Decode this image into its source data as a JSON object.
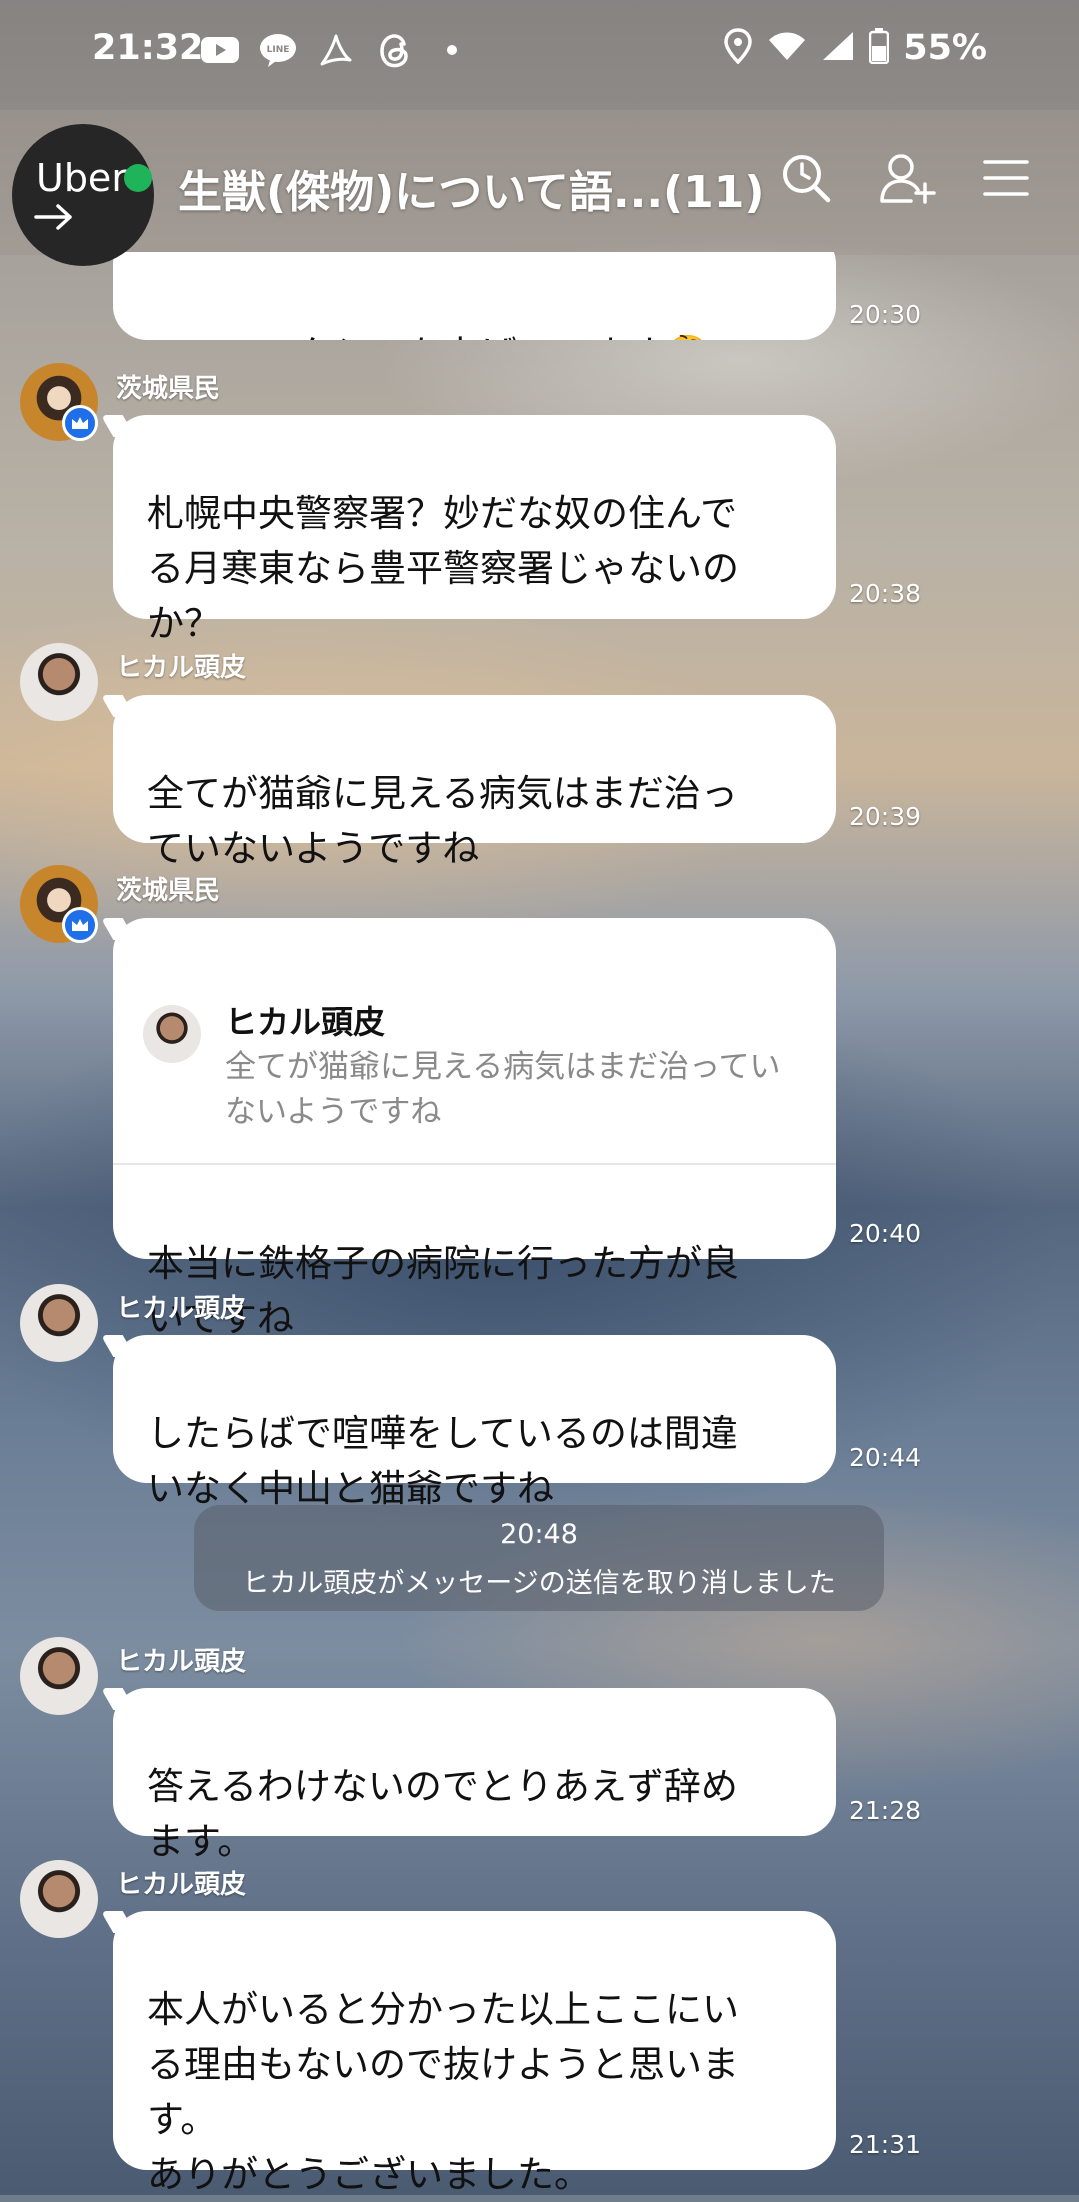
{
  "status_bar": {
    "time": "21:32",
    "battery": "55%",
    "left_icons": [
      "youtube-icon",
      "line-icon",
      "acrobat-icon",
      "threads-icon",
      "dot-icon"
    ],
    "right_icons": [
      "location-icon",
      "wifi-icon",
      "signal-icon",
      "battery-icon"
    ]
  },
  "overlay": {
    "uber_label": "Uber"
  },
  "header": {
    "title": "生獣(傑物)について語...(11)",
    "buttons": [
      "search-icon",
      "add-friend-icon",
      "menu-icon"
    ]
  },
  "messages": [
    {
      "type": "text",
      "sender": "",
      "text": "ここのスクショを上げています🤔",
      "time": "20:30"
    },
    {
      "type": "text",
      "sender": "茨城県民",
      "text": "札幌中央警察署？妙だな奴の住んで\nる月寒東なら豊平警察署じゃないの\nか？",
      "time": "20:38"
    },
    {
      "type": "text",
      "sender": "ヒカル頭皮",
      "text": "全てが猫爺に見える病気はまだ治っ\nていないようですね",
      "time": "20:39"
    },
    {
      "type": "reply",
      "sender": "茨城県民",
      "reply_to_name": "ヒカル頭皮",
      "reply_to_text": "全てが猫爺に見える病気はまだ治ってい\nないようですね",
      "text": "本当に鉄格子の病院に行った方が良\nいですね",
      "time": "20:40"
    },
    {
      "type": "text",
      "sender": "ヒカル頭皮",
      "text": "したらばで喧嘩をしているのは間違\nいなく中山と猫爺ですね",
      "time": "20:44"
    },
    {
      "type": "system",
      "time": "20:48",
      "text": "ヒカル頭皮がメッセージの送信を取り消しました"
    },
    {
      "type": "text",
      "sender": "ヒカル頭皮",
      "text": "答えるわけないのでとりあえず辞め\nます。",
      "time": "21:28"
    },
    {
      "type": "text",
      "sender": "ヒカル頭皮",
      "text": "本人がいると分かった以上ここにい\nる理由もないので抜けようと思いま\nす。\nありがとうございました。",
      "time": "21:31"
    }
  ]
}
